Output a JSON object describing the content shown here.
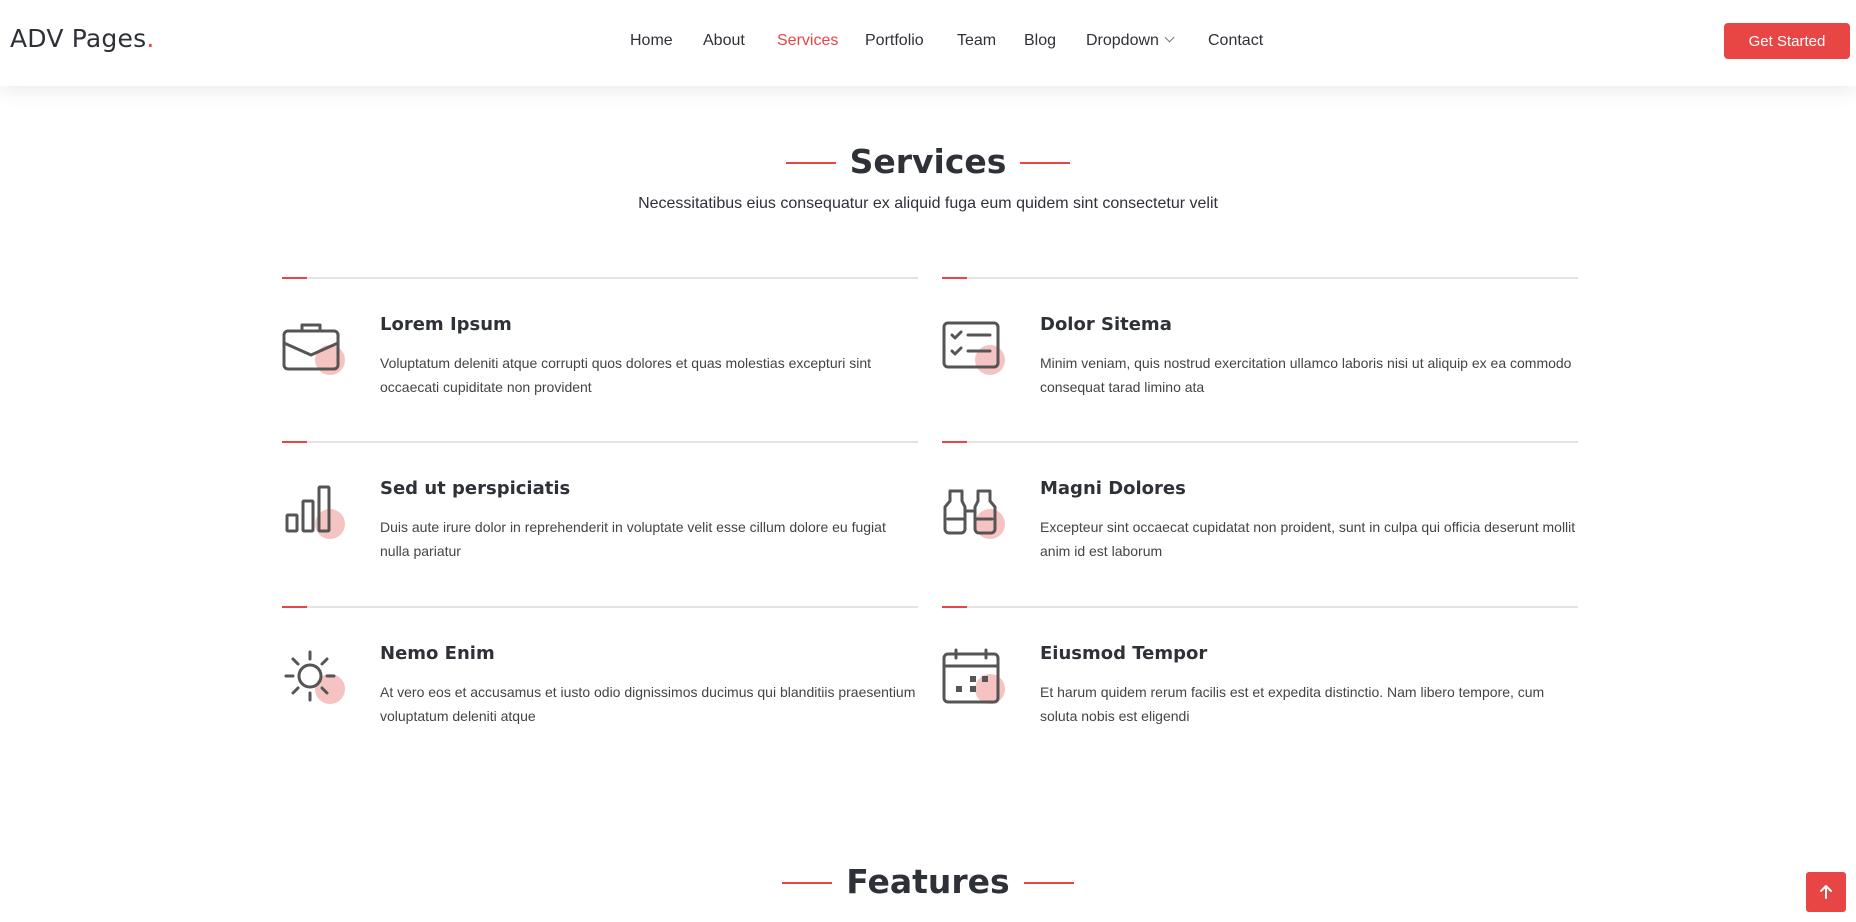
{
  "header": {
    "logo": "ADV Pages",
    "logo_dot": ".",
    "nav": [
      {
        "label": "Home",
        "active": false
      },
      {
        "label": "About",
        "active": false
      },
      {
        "label": "Services",
        "active": true
      },
      {
        "label": "Portfolio",
        "active": false
      },
      {
        "label": "Team",
        "active": false
      },
      {
        "label": "Blog",
        "active": false
      },
      {
        "label": "Dropdown",
        "active": false
      },
      {
        "label": "Contact",
        "active": false
      }
    ],
    "cta_label": "Get Started"
  },
  "services": {
    "title": "Services",
    "subtitle": "Necessitatibus eius consequatur ex aliquid fuga eum quidem sint consectetur velit",
    "items": [
      {
        "icon": "briefcase-icon",
        "title": "Lorem Ipsum",
        "text": "Voluptatum deleniti atque corrupti quos dolores et quas molestias excepturi sint occaecati cupiditate non provident"
      },
      {
        "icon": "checklist-icon",
        "title": "Dolor Sitema",
        "text": "Minim veniam, quis nostrud exercitation ullamco laboris nisi ut aliquip ex ea commodo consequat tarad limino ata"
      },
      {
        "icon": "bar-chart-icon",
        "title": "Sed ut perspiciatis",
        "text": "Duis aute irure dolor in reprehenderit in voluptate velit esse cillum dolore eu fugiat nulla pariatur"
      },
      {
        "icon": "binoculars-icon",
        "title": "Magni Dolores",
        "text": "Excepteur sint occaecat cupidatat non proident, sunt in culpa qui officia deserunt mollit anim id est laborum"
      },
      {
        "icon": "sun-icon",
        "title": "Nemo Enim",
        "text": "At vero eos et accusamus et iusto odio dignissimos ducimus qui blanditiis praesentium voluptatum deleniti atque"
      },
      {
        "icon": "calendar-icon",
        "title": "Eiusmod Tempor",
        "text": "Et harum quidem rerum facilis est et expedita distinctio. Nam libero tempore, cum soluta nobis est eligendi"
      }
    ]
  },
  "features": {
    "title": "Features"
  },
  "colors": {
    "accent": "#e84545",
    "text": "#2f3138",
    "icon_blob": "#f6c3c3"
  },
  "back_to_top_icon": "arrow-up-icon"
}
